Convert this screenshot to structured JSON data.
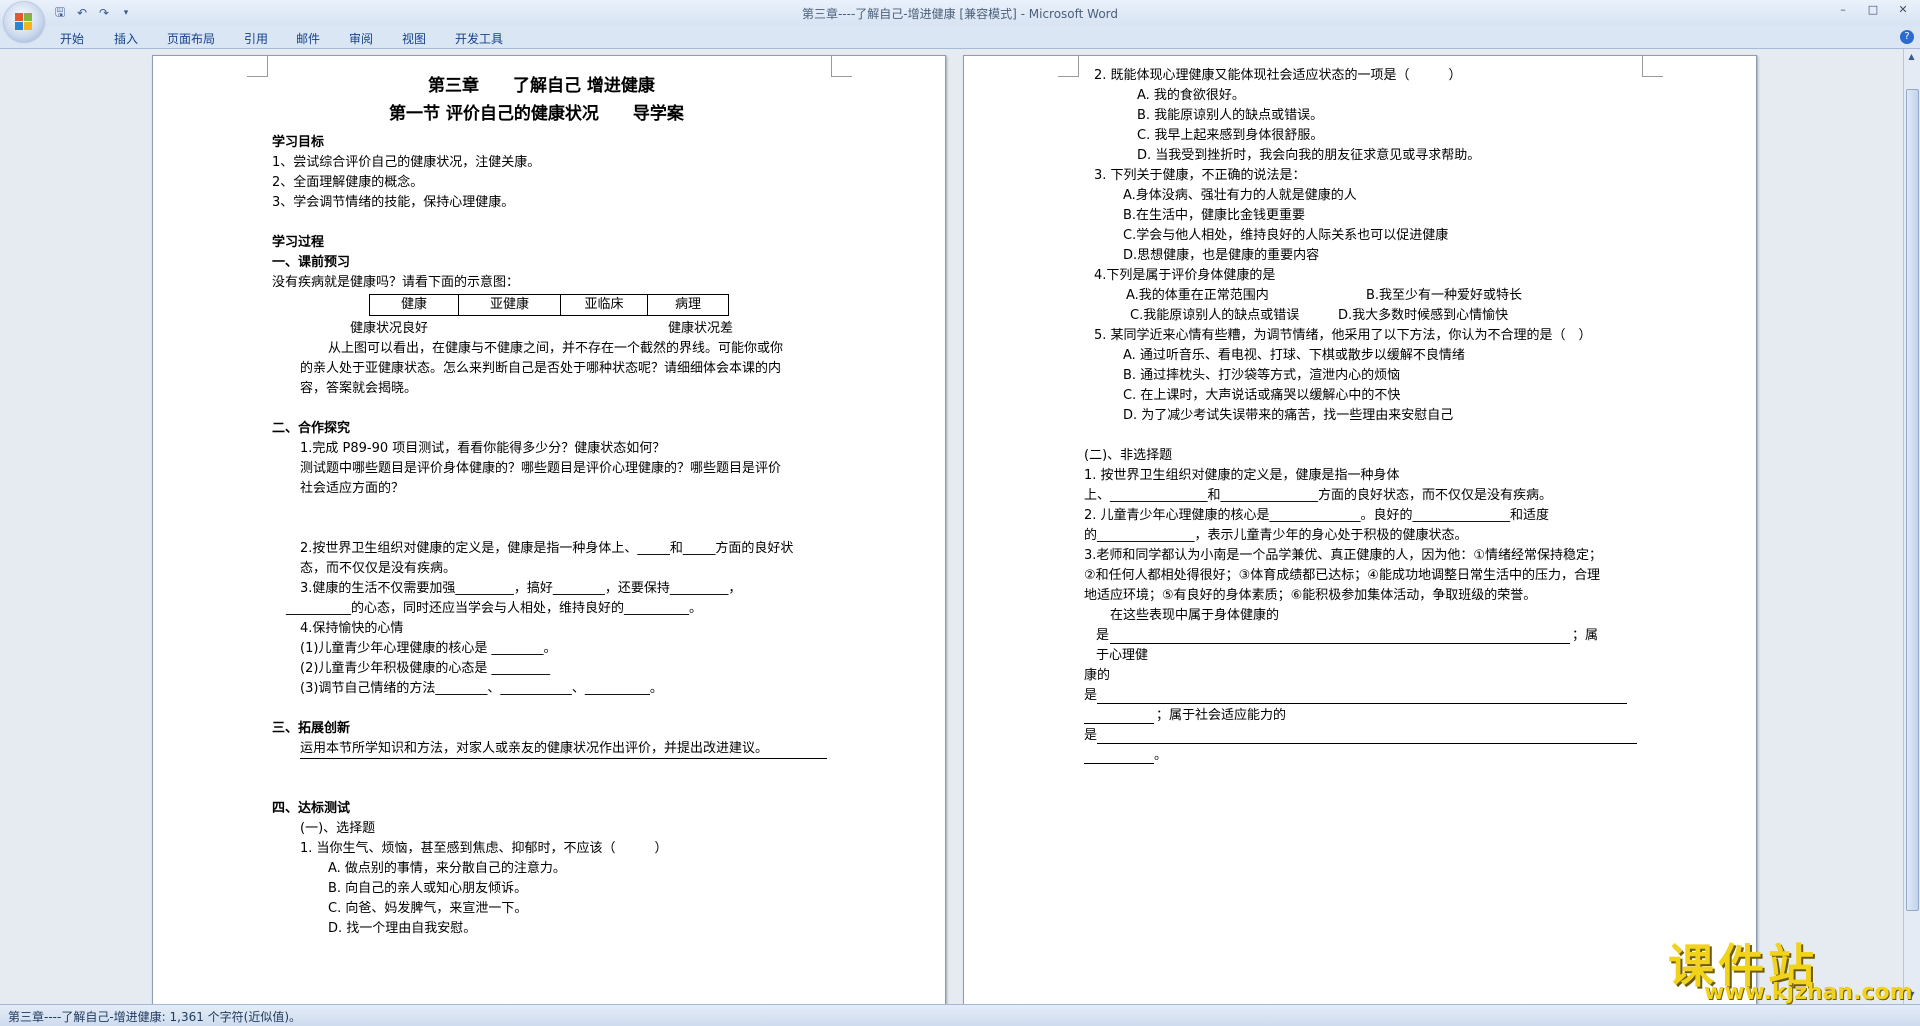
{
  "window": {
    "title": "第三章----了解自己-增进健康 [兼容模式] - Microsoft Word"
  },
  "ribbon": {
    "tabs": [
      "开始",
      "插入",
      "页面布局",
      "引用",
      "邮件",
      "审阅",
      "视图",
      "开发工具"
    ]
  },
  "status": {
    "text": "第三章----了解自己-增进健康: 1,361 个字符(近似值)。"
  },
  "watermark": {
    "main": "课件站",
    "sub": "www.kjzhan.com"
  },
  "page_left": {
    "chapter_title": "第三章　　了解自己 增进健康",
    "section_title": "第一节 评价自己的健康状况　　导学案",
    "goals_heading": "学习目标",
    "goals": [
      "1、尝试综合评价自己的健康状况，注健关康。",
      "2、全面理解健康的概念。",
      "3、学会调节情绪的技能，保持心理健康。"
    ],
    "process_heading": "学习过程",
    "preview_heading": "一、课前预习",
    "preview_q": "没有疾病就是健康吗？请看下面的示意图：",
    "diagram_cells": [
      "健康",
      "亚健康",
      "亚临床",
      "病理"
    ],
    "diagram_left": "健康状况良好",
    "diagram_right": "健康状况差",
    "preview_para": [
      "从上图可以看出，在健康与不健康之间，并不存在一个截然的界线。可能你或你",
      "的亲人处于亚健康状态。怎么来判断自己是否处于哪种状态呢？请细细体会本课的内",
      "容，答案就会揭晓。"
    ],
    "coop_heading": "二、合作探究",
    "coop_lines": [
      "1.完成 P89-90 项目测试，看看你能得多少分？健康状态如何？",
      "测试题中哪些题目是评价身体健康的？哪些题目是评价心理健康的？哪些题目是评价",
      "社会适应方面的？"
    ],
    "coop_q2": "2.按世界卫生组织对健康的定义是，健康是指一种身体上、_____和_____方面的良好状",
    "coop_q2b": "态，而不仅仅是没有疾病。",
    "coop_q3": "3.健康的生活不仅需要加强_________，搞好________，还要保持_________，",
    "coop_q3b": "__________的心态，同时还应当学会与人相处，维持良好的__________。",
    "coop_q4": "4.保持愉快的心情",
    "coop_q4a": "(1)儿童青少年心理健康的核心是 ________。",
    "coop_q4b": "(2)儿童青少年积极健康的心态是 _________",
    "coop_q4c": "(3)调节自己情绪的方法________、___________、__________。",
    "extend_heading": "三、拓展创新",
    "extend_text": "运用本节所学知识和方法，对家人或亲友的健康状况作出评价，并提出改进建议。",
    "test_heading": "四、达标测试",
    "choice_heading": "(一)、选择题",
    "q1": "1. 当你生气、烦恼，甚至感到焦虑、抑郁时，不应该（　　　）",
    "q1_options": [
      "A. 做点别的事情，来分散自己的注意力。",
      "B. 向自己的亲人或知心朋友倾诉。",
      "C. 向爸、妈发脾气，来宣泄一下。",
      "D. 找一个理由自我安慰。"
    ]
  },
  "page_right": {
    "q2": "2. 既能体现心理健康又能体现社会适应状态的一项是（　　　）",
    "q2_options": [
      "A. 我的食欲很好。",
      "B. 我能原谅别人的缺点或错误。",
      "C. 我早上起来感到身体很舒服。",
      "D. 当我受到挫折时，我会向我的朋友征求意见或寻求帮助。"
    ],
    "q3": "3. 下列关于健康，不正确的说法是：",
    "q3_options": [
      "A.身体没病、强壮有力的人就是健康的人",
      "B.在生活中，健康比金钱更重要",
      "C.学会与他人相处，维持良好的人际关系也可以促进健康",
      "D.思想健康，也是健康的重要内容"
    ],
    "q4": "4.下列是属于评价身体健康的是",
    "q4_options": [
      "A.我的体重在正常范围内",
      "B.我至少有一种爱好或特长",
      "C.我能原谅别人的缺点或错误",
      "D.我大多数时候感到心情愉快"
    ],
    "q5": "5. 某同学近来心情有些糟，为调节情绪，他采用了以下方法，你认为不合理的是（　）",
    "q5_options": [
      "A. 通过听音乐、看电视、打球、下棋或散步以缓解不良情绪",
      "B. 通过摔枕头、打沙袋等方式，渲泄内心的烦恼",
      "C. 在上课时，大声说话或痛哭以缓解心中的不快",
      "D. 为了减少考试失误带来的痛苦，找一些理由来安慰自己"
    ],
    "nonchoice_heading": "(二)、非选择题",
    "n1": "1. 按世界卫生组织对健康的定义是，健康是指一种身体",
    "n1b": "上、_______________和_______________方面的良好状态，而不仅仅是没有疾病。",
    "n2": "2. 儿童青少年心理健康的核心是______________。良好的_______________和适度",
    "n2b": "的_______________，表示儿童青少年的身心处于积极的健康状态。",
    "n3": "3.老师和同学都认为小南是一个品学兼优、真正健康的人，因为他：①情绪经常保持稳定；",
    "n3b": "②和任何人都相处得很好；③体育成绩都已达标；④能成功地调整日常生活中的压力，合理",
    "n3c": "地适应环境；⑤有良好的身体素质；⑥能积极参加集体活动，争取班级的荣誉。",
    "n3d": "在这些表现中属于身体健康的",
    "n3e": "是",
    "n3e_tail": "；属",
    "n3f": "于心理健",
    "n3g": "康的",
    "n3h": "是",
    "n3i": "；属于社会适应能力的",
    "n3j": "是",
    "n3k": "。"
  }
}
